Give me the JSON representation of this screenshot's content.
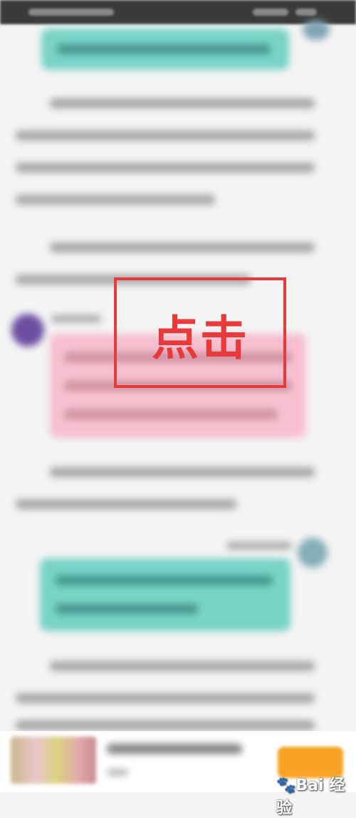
{
  "overlay": {
    "highlight_label": "点击",
    "highlight_color": "#e83a3a"
  },
  "watermark": {
    "text": "Bai 经验",
    "icon": "paw-icon"
  },
  "colors": {
    "teal_bubble": "#79d3c7",
    "pink_bubble": "#f7bfcf",
    "orange_button": "#f7a425",
    "status_bar": "#3a3a3a"
  }
}
